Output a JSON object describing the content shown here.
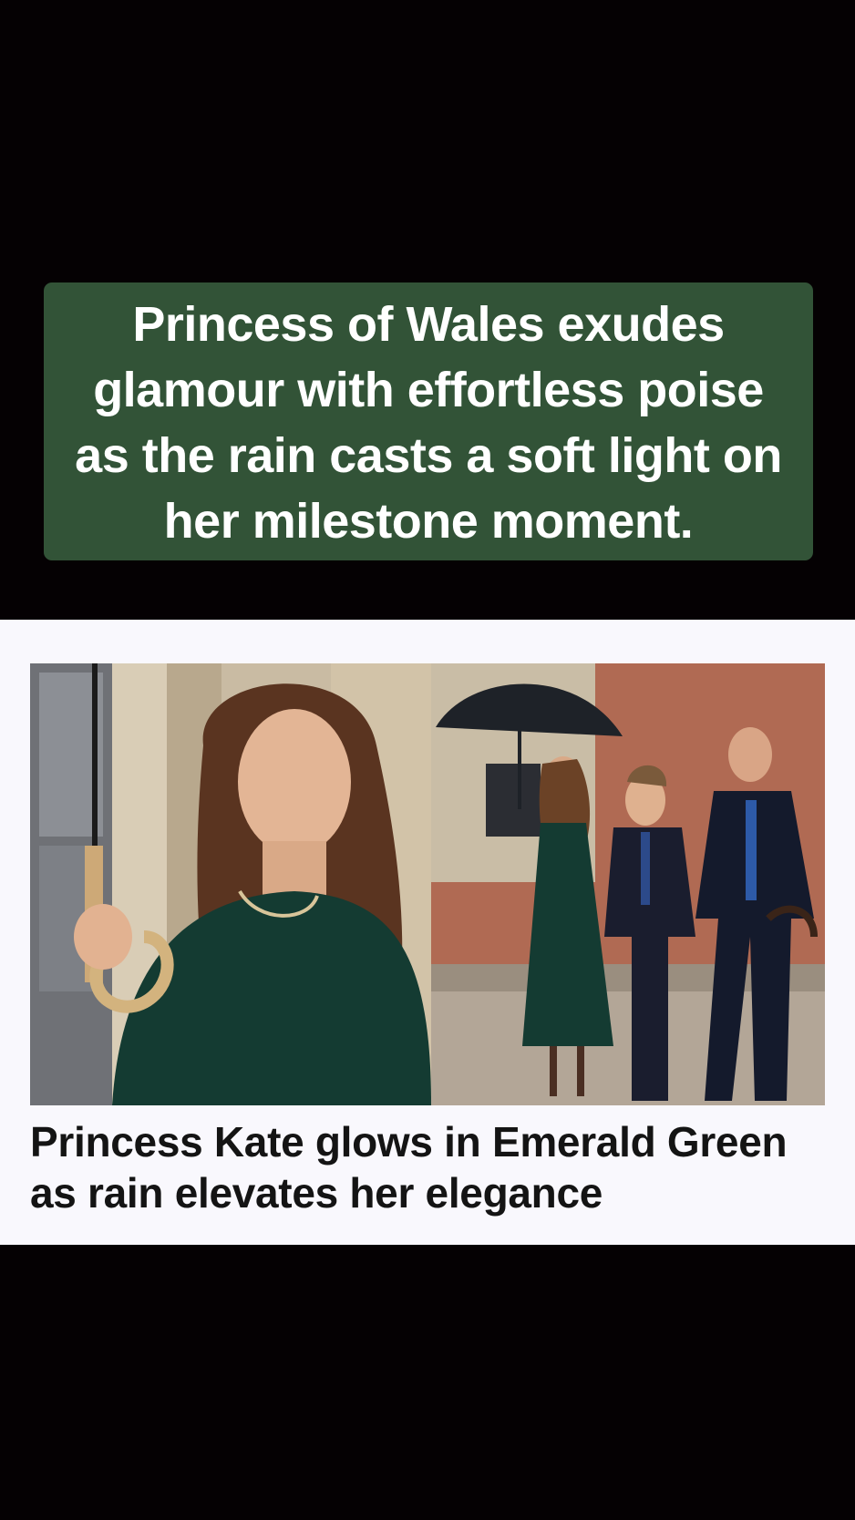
{
  "caption": {
    "text": "Princess of Wales exudes glamour with effortless poise as the rain casts a soft light on her milestone moment."
  },
  "article": {
    "headline": "Princess Kate glows in Emerald Green as rain elevates her elegance"
  },
  "colors": {
    "page_background": "#050103",
    "caption_background": "#325337",
    "card_background": "#f9f8fd"
  }
}
